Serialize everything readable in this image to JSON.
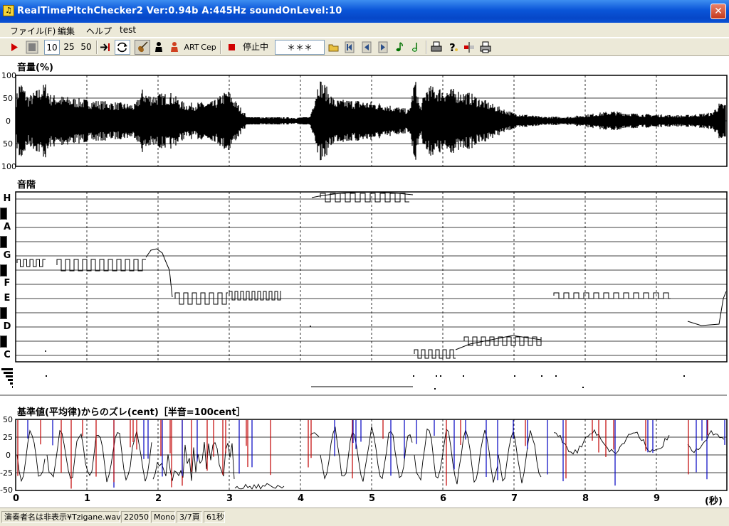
{
  "window": {
    "title": "RealTimePitchChecker2   Ver:0.94b      A:445Hz     soundOnLevel:10",
    "close_glyph": "✕"
  },
  "menu": {
    "file": "ファイル(F)",
    "edit": "編集",
    "help": "ヘルプ",
    "test": "test"
  },
  "toolbar": {
    "play_icon": "play-icon",
    "stop_icon": "stop-icon",
    "speed_10": "10",
    "speed_25": "25",
    "speed_50": "50",
    "art": "ART",
    "cep": "Cep",
    "status": "停止中",
    "note_display": "＊＊＊"
  },
  "panels": {
    "volume": {
      "title": "音量(%)",
      "yticks": [
        "100",
        "50",
        "0",
        "50",
        "100"
      ]
    },
    "scale": {
      "title": "音階",
      "notes": [
        "H",
        "A",
        "G",
        "F",
        "E",
        "D",
        "C"
      ]
    },
    "deviation": {
      "title": "基準値(平均律)からのズレ(cent)［半音=100cent］",
      "yticks": [
        "50",
        "25",
        "0",
        "-25",
        "-50"
      ]
    }
  },
  "xaxis": {
    "ticks": [
      "0",
      "1",
      "2",
      "3",
      "4",
      "5",
      "6",
      "7",
      "8",
      "9"
    ],
    "unit": "(秒)"
  },
  "statusbar": {
    "file": "演奏者名は非表示¥Tzigane.wav",
    "rate": "22050",
    "channels": "Mono",
    "page": "3/7頁",
    "length": "61秒"
  },
  "colors": {
    "titlebar": "#0a55d8",
    "face": "#ece9d8",
    "plot_line": "#000000",
    "dev_red": "#c00000",
    "dev_blue": "#0000c0"
  }
}
